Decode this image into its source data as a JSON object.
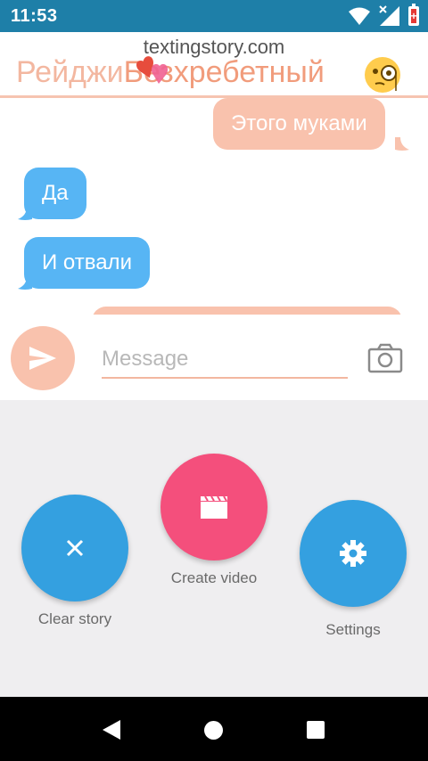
{
  "status_bar": {
    "time": "11:53"
  },
  "header": {
    "watermark": "textingstory.com",
    "contact_name_part1": "Рейджи",
    "contact_name_part2": "Безхребетный"
  },
  "chat": {
    "messages": [
      {
        "text": "Этого муками",
        "direction": "outgoing"
      },
      {
        "text": "Да",
        "direction": "incoming"
      },
      {
        "text": "И отвали",
        "direction": "incoming"
      },
      {
        "text": "",
        "direction": "outgoing"
      }
    ]
  },
  "composer": {
    "placeholder": "Message"
  },
  "actions": {
    "clear_label": "Clear story",
    "create_label": "Create video",
    "settings_label": "Settings"
  },
  "colors": {
    "status_bar": "#1e7fa8",
    "outgoing_bubble": "#f9c2ad",
    "incoming_bubble": "#57b5f4",
    "fab_blue": "#34a0e0",
    "fab_pink": "#f44f7c",
    "panel_bg": "#efeef0"
  },
  "icons": {
    "send": "send-icon",
    "camera": "camera-icon",
    "clear": "close-icon",
    "create": "clapperboard-icon",
    "settings": "gear-icon"
  }
}
